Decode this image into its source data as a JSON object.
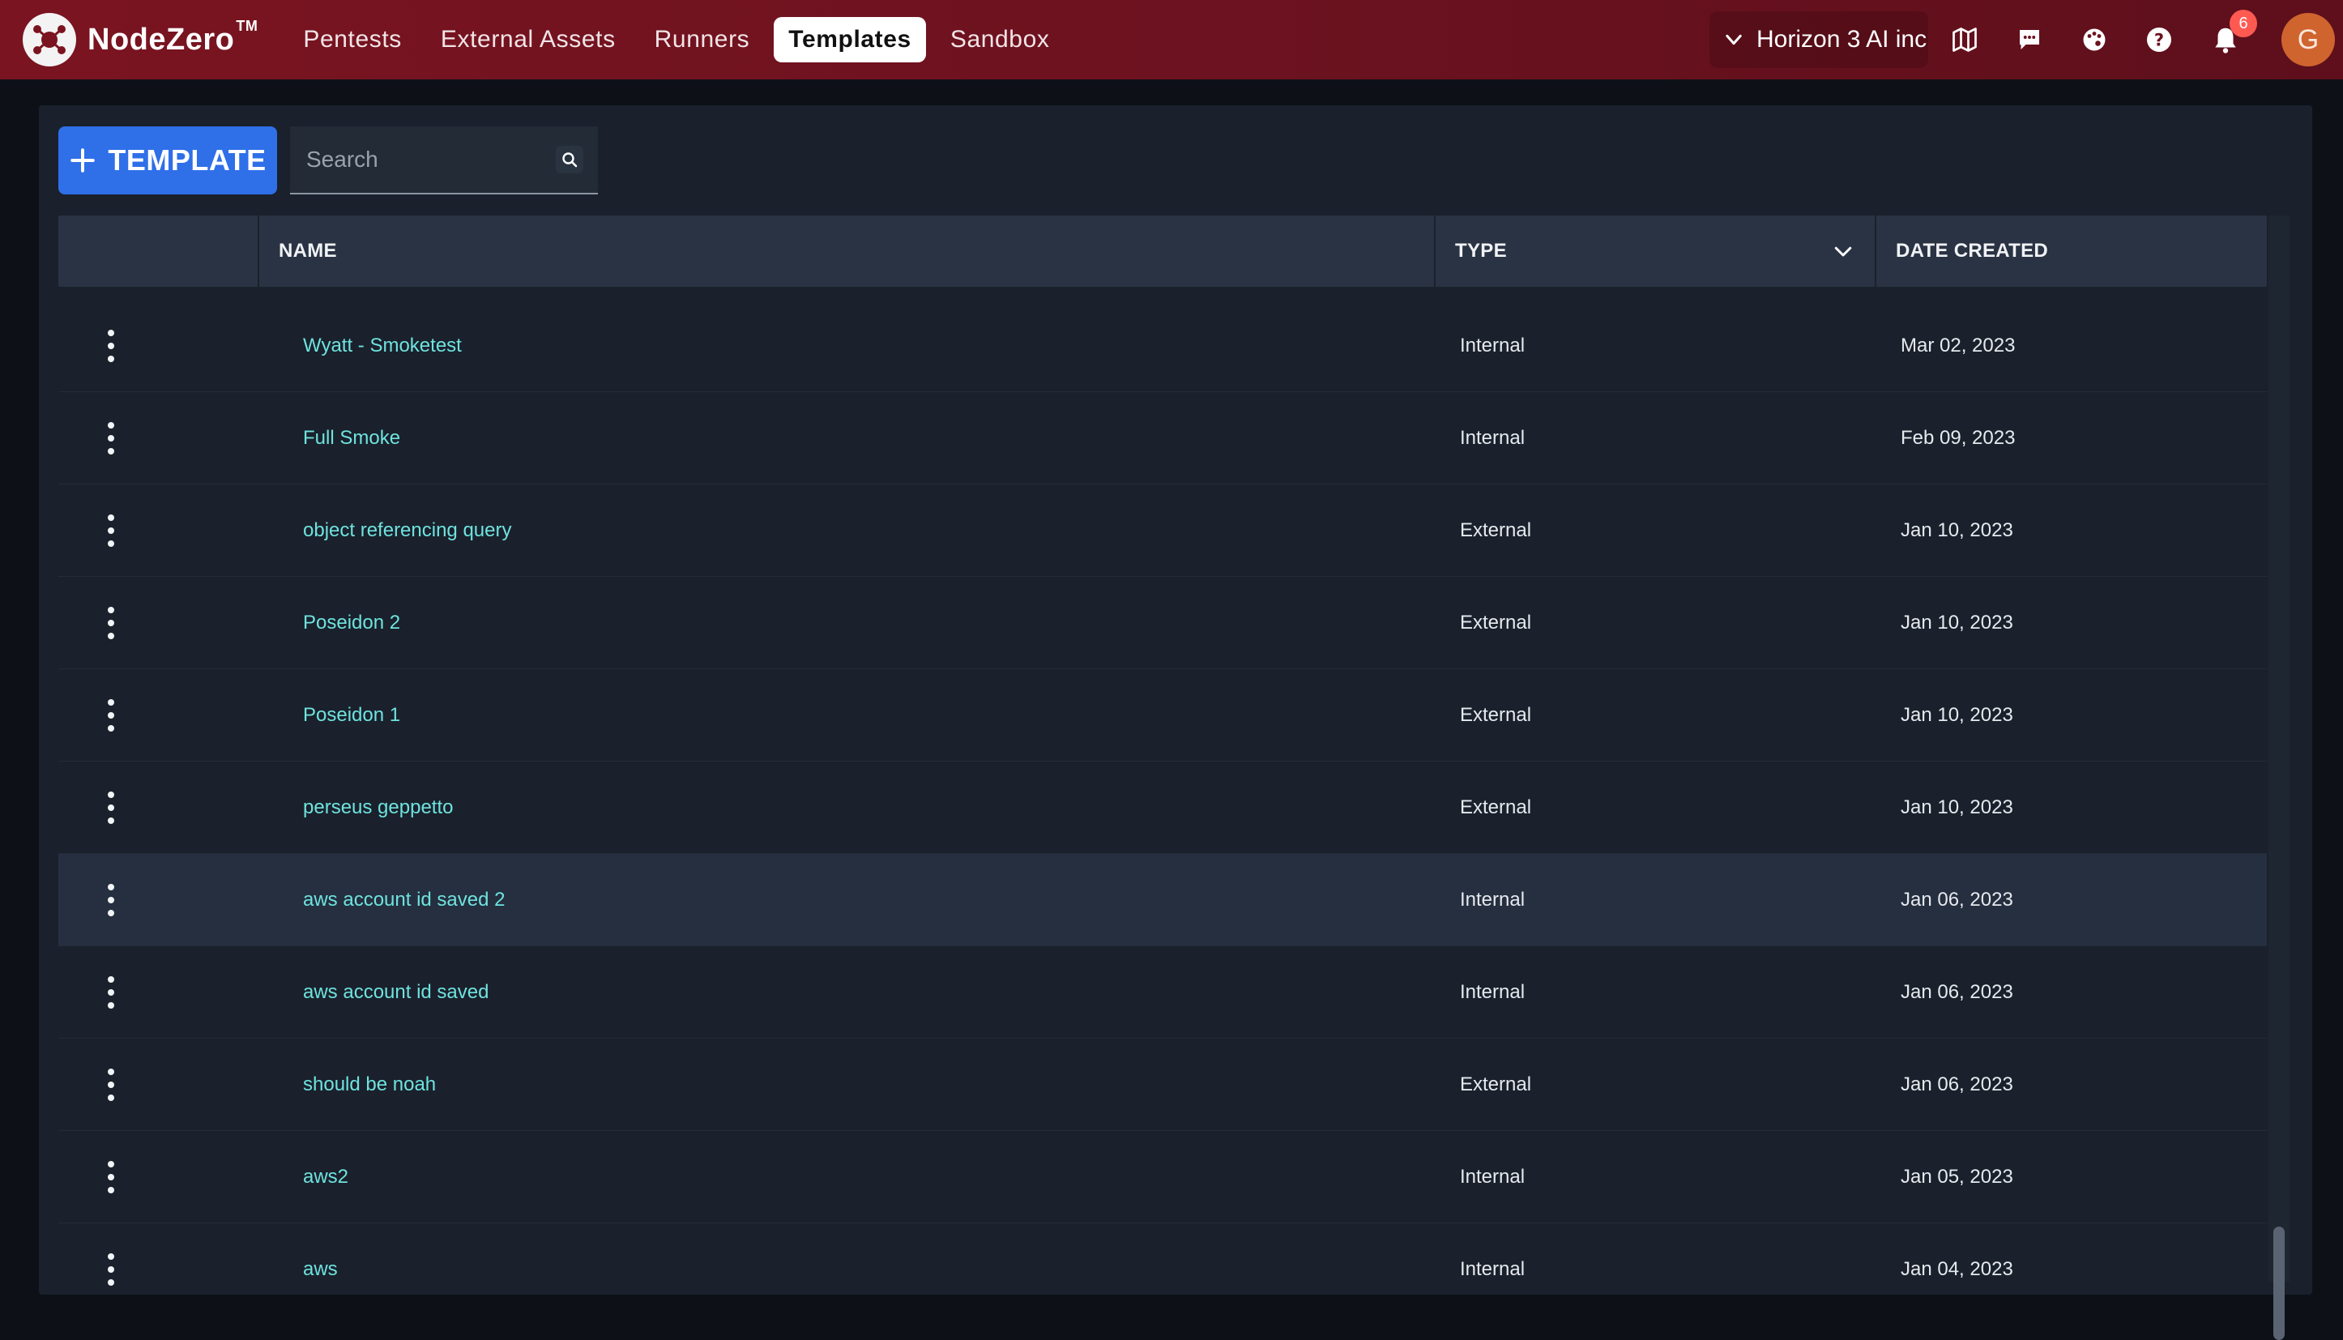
{
  "app": {
    "brand": "NodeZero",
    "trademark": "TM"
  },
  "nav": {
    "items": [
      {
        "label": "Pentests",
        "active": false
      },
      {
        "label": "External Assets",
        "active": false
      },
      {
        "label": "Runners",
        "active": false
      },
      {
        "label": "Templates",
        "active": true
      },
      {
        "label": "Sandbox",
        "active": false
      }
    ]
  },
  "header": {
    "org_name": "Horizon 3 AI inc",
    "notification_count": "6",
    "avatar_initial": "G",
    "icons": [
      "map-icon",
      "chat-icon",
      "palette-icon",
      "help-icon",
      "bell-icon"
    ]
  },
  "toolbar": {
    "add_label": "TEMPLATE",
    "search_placeholder": "Search",
    "search_value": ""
  },
  "table": {
    "columns": {
      "actions": "",
      "name": "NAME",
      "type": "TYPE",
      "date": "DATE CREATED"
    },
    "rows": [
      {
        "name": "Wyatt - Smoketest",
        "type": "Internal",
        "date": "Mar 02, 2023"
      },
      {
        "name": "Full Smoke",
        "type": "Internal",
        "date": "Feb 09, 2023"
      },
      {
        "name": "object referencing query",
        "type": "External",
        "date": "Jan 10, 2023"
      },
      {
        "name": "Poseidon 2",
        "type": "External",
        "date": "Jan 10, 2023"
      },
      {
        "name": "Poseidon 1",
        "type": "External",
        "date": "Jan 10, 2023"
      },
      {
        "name": "perseus geppetto",
        "type": "External",
        "date": "Jan 10, 2023"
      },
      {
        "name": "aws account id saved 2",
        "type": "Internal",
        "date": "Jan 06, 2023"
      },
      {
        "name": "aws account id saved",
        "type": "Internal",
        "date": "Jan 06, 2023"
      },
      {
        "name": "should be noah",
        "type": "External",
        "date": "Jan 06, 2023"
      },
      {
        "name": "aws2",
        "type": "Internal",
        "date": "Jan 05, 2023"
      },
      {
        "name": "aws",
        "type": "Internal",
        "date": "Jan 04, 2023"
      }
    ]
  },
  "colors": {
    "topbar": "#6d1220",
    "accent_blue": "#2f6fe8",
    "link_teal": "#6fe3df",
    "badge_red": "#ff5a52",
    "avatar_orange": "#d0642f"
  }
}
